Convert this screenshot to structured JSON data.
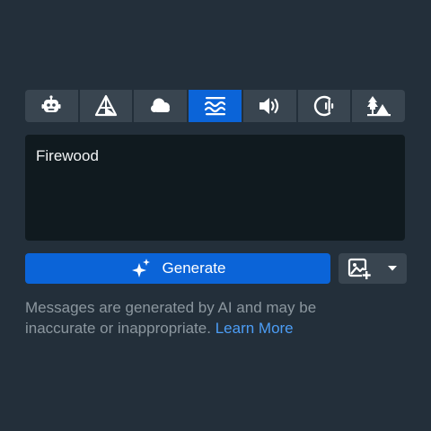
{
  "tabs": [
    {
      "name": "robot",
      "icon": "robot-icon",
      "active": false
    },
    {
      "name": "prism",
      "icon": "prism-icon",
      "active": false
    },
    {
      "name": "weather",
      "icon": "cloud-icon",
      "active": false
    },
    {
      "name": "waves",
      "icon": "waves-icon",
      "active": true
    },
    {
      "name": "sound",
      "icon": "speaker-icon",
      "active": false
    },
    {
      "name": "voice",
      "icon": "voice-icon",
      "active": false
    },
    {
      "name": "scene",
      "icon": "trees-mountain-icon",
      "active": false
    }
  ],
  "prompt": {
    "value": "Firewood"
  },
  "generate": {
    "label": "Generate",
    "icon": "sparkles-icon"
  },
  "image_button": {
    "icon": "add-image-icon",
    "dropdown_icon": "caret-down-icon"
  },
  "disclaimer": {
    "text": "Messages are generated by AI and may be inaccurate or inappropriate.",
    "link": "Learn More"
  },
  "colors": {
    "background": "#232f3a",
    "tab": "#394550",
    "accent": "#0b64d8",
    "input_bg": "#101a1f",
    "link": "#4c9df5",
    "muted_text": "#8c979f"
  }
}
